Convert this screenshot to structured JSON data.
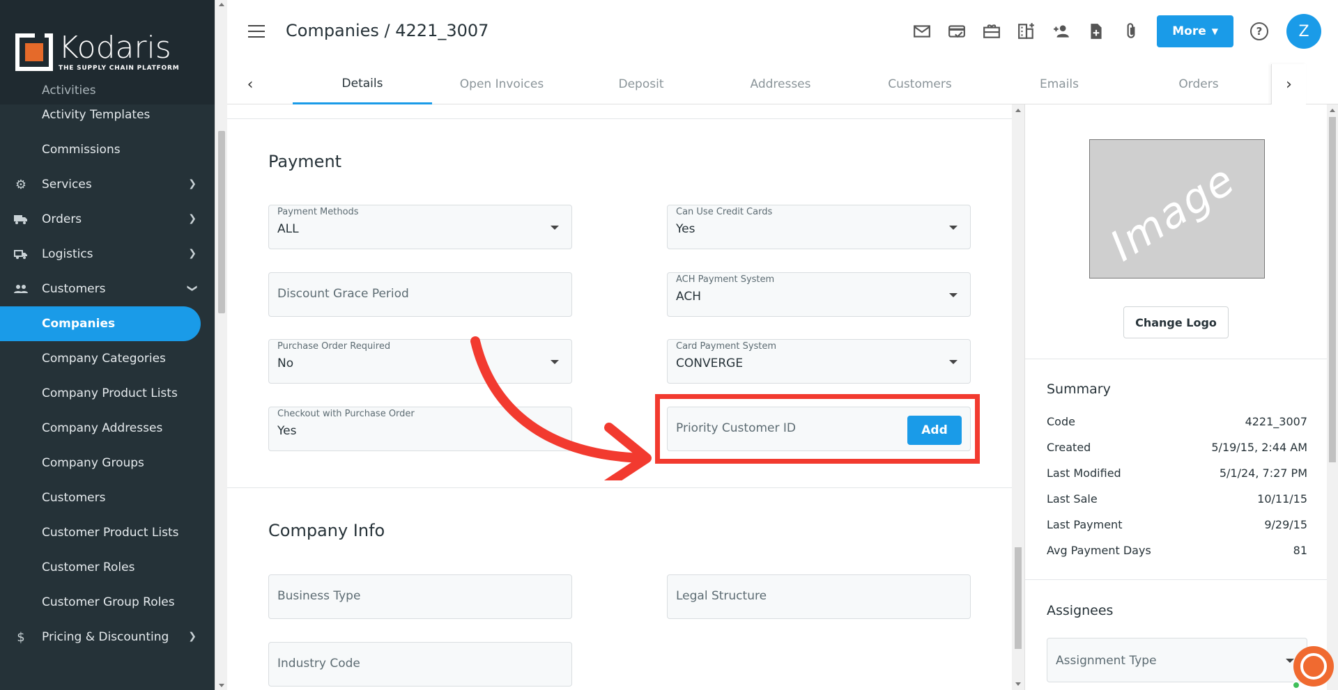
{
  "brand": {
    "name": "Kodaris",
    "tagline": "THE SUPPLY CHAIN PLATFORM",
    "accent": "#1a9be8",
    "logo_color": "#e56a2a"
  },
  "sidebar": {
    "cut_item": "Activities",
    "items": [
      {
        "label": "Activity Templates",
        "type": "sub"
      },
      {
        "label": "Commissions",
        "type": "sub"
      },
      {
        "label": "Services",
        "type": "group",
        "icon": "gears-icon"
      },
      {
        "label": "Orders",
        "type": "group",
        "icon": "truck-icon"
      },
      {
        "label": "Logistics",
        "type": "group",
        "icon": "delivery-icon"
      },
      {
        "label": "Customers",
        "type": "group-open",
        "icon": "people-icon"
      },
      {
        "label": "Companies",
        "type": "sub-active"
      },
      {
        "label": "Company Categories",
        "type": "sub"
      },
      {
        "label": "Company Product Lists",
        "type": "sub"
      },
      {
        "label": "Company Addresses",
        "type": "sub"
      },
      {
        "label": "Company Groups",
        "type": "sub"
      },
      {
        "label": "Customers",
        "type": "sub"
      },
      {
        "label": "Customer Product Lists",
        "type": "sub"
      },
      {
        "label": "Customer Roles",
        "type": "sub"
      },
      {
        "label": "Customer Group Roles",
        "type": "sub"
      },
      {
        "label": "Pricing & Discounting",
        "type": "group",
        "icon": "dollar-icon"
      }
    ]
  },
  "header": {
    "title": "Companies / 4221_3007",
    "more_label": "More",
    "avatar_initial": "Z",
    "toolbar_icons": [
      "mail-icon",
      "card-check-icon",
      "gift-card-icon",
      "building-add-icon",
      "person-add-icon",
      "file-add-icon",
      "attachment-icon"
    ]
  },
  "tabs": [
    "Details",
    "Open Invoices",
    "Deposit",
    "Addresses",
    "Customers",
    "Emails",
    "Orders"
  ],
  "payment": {
    "title": "Payment",
    "payment_methods": {
      "label": "Payment Methods",
      "value": "ALL"
    },
    "can_use_credit_cards": {
      "label": "Can Use Credit Cards",
      "value": "Yes"
    },
    "discount_grace_period": {
      "placeholder": "Discount Grace Period"
    },
    "ach_payment_system": {
      "label": "ACH Payment System",
      "value": "ACH"
    },
    "purchase_order_required": {
      "label": "Purchase Order Required",
      "value": "No"
    },
    "card_payment_system": {
      "label": "Card Payment System",
      "value": "CONVERGE"
    },
    "checkout_with_po": {
      "label": "Checkout with Purchase Order",
      "value": "Yes"
    },
    "priority_customer_id": {
      "placeholder": "Priority Customer ID",
      "button": "Add"
    }
  },
  "company_info": {
    "title": "Company Info",
    "business_type": {
      "placeholder": "Business Type"
    },
    "legal_structure": {
      "placeholder": "Legal Structure"
    },
    "industry_code": {
      "placeholder": "Industry Code"
    }
  },
  "right_panel": {
    "image_placeholder": "Image",
    "change_logo": "Change Logo",
    "summary_title": "Summary",
    "summary": [
      {
        "key": "Code",
        "value": "4221_3007"
      },
      {
        "key": "Created",
        "value": "5/19/15, 2:44 AM"
      },
      {
        "key": "Last Modified",
        "value": "5/1/24, 7:27 PM"
      },
      {
        "key": "Last Sale",
        "value": "10/11/15"
      },
      {
        "key": "Last Payment",
        "value": "9/29/15"
      },
      {
        "key": "Avg Payment Days",
        "value": "81"
      }
    ],
    "assignees_title": "Assignees",
    "assignment_type_placeholder": "Assignment Type"
  },
  "annotation_color": "#f23a2f"
}
